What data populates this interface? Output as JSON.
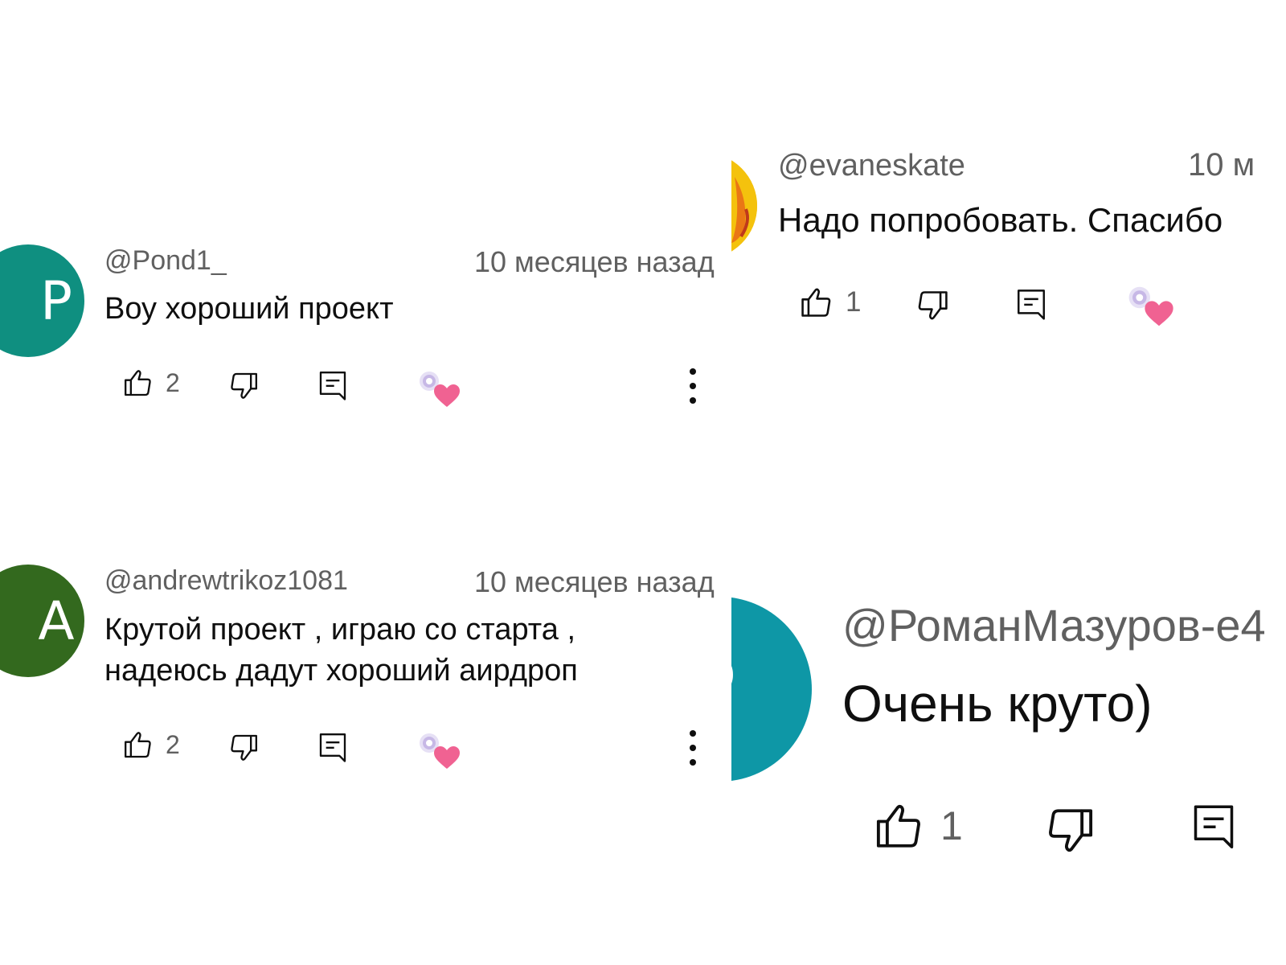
{
  "comments": [
    {
      "author": "@Pond1_",
      "time": "10 месяцев назад",
      "text": "Воу хороший проект",
      "avatar_letter": "P",
      "avatar_color": "#0f8f80",
      "likes": "2"
    },
    {
      "author": "@evaneskate",
      "time": "10 м",
      "text": "Надо попробовать. Спасибо",
      "avatar_color": "#f2b705",
      "likes": "1"
    },
    {
      "author": "@andrewtrikoz1081",
      "time": "10 месяцев назад",
      "text_line1": "Крутой проект , играю со старта ,",
      "text_line2": "надеюсь дадут хороший аирдроп",
      "avatar_letter": "A",
      "avatar_color": "#33691e",
      "likes": "2"
    },
    {
      "author": "@РоманМазуров-е4",
      "text": "Очень круто)",
      "avatar_letter": "Р",
      "avatar_color": "#0e97a6",
      "likes": "1"
    }
  ],
  "icons": {
    "like": "thumbs-up-icon",
    "dislike": "thumbs-down-icon",
    "reply": "reply-comment-icon",
    "creator_heart": "creator-heart-icon",
    "more": "more-vertical-icon"
  },
  "colors": {
    "meta_text": "#606060",
    "heart": "#f06292"
  }
}
